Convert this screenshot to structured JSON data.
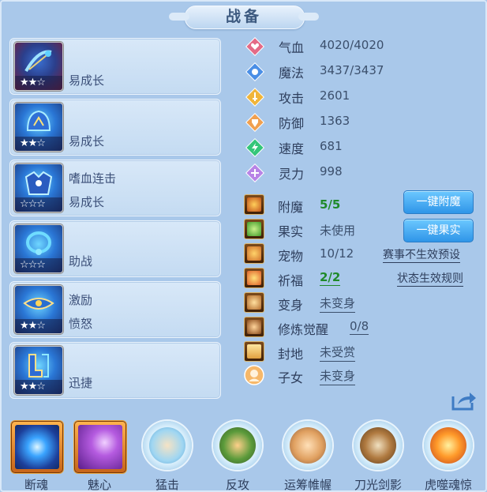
{
  "title": "战备",
  "equipment": [
    {
      "line1": "",
      "line2": "易成长",
      "stars": "★★☆"
    },
    {
      "line1": "",
      "line2": "易成长",
      "stars": "★★☆"
    },
    {
      "line1": "嗜血连击",
      "line2": "易成长",
      "stars": "☆☆☆"
    },
    {
      "line1": "",
      "line2": "助战",
      "stars": "☆☆☆"
    },
    {
      "line1": "激励",
      "line2": "愤怒",
      "stars": "★★☆"
    },
    {
      "line1": "",
      "line2": "迅捷",
      "stars": "★★☆"
    }
  ],
  "stats": [
    {
      "label": "气血",
      "value": "4020/4020",
      "color": "#e46a86",
      "icon": "heart-icon"
    },
    {
      "label": "魔法",
      "value": "3437/3437",
      "color": "#4b8fe6",
      "icon": "mana-icon"
    },
    {
      "label": "攻击",
      "value": "2601",
      "color": "#f0b53a",
      "icon": "sword-icon"
    },
    {
      "label": "防御",
      "value": "1363",
      "color": "#f0a050",
      "icon": "shield-icon"
    },
    {
      "label": "速度",
      "value": "681",
      "color": "#34c67a",
      "icon": "lightning-icon"
    },
    {
      "label": "灵力",
      "value": "998",
      "color": "#b884e6",
      "icon": "spirit-icon"
    }
  ],
  "details": {
    "enchant": {
      "label": "附魔",
      "value": "5/5"
    },
    "fruit": {
      "label": "果实",
      "value": "未使用"
    },
    "pet": {
      "label": "宠物",
      "value": "10/12"
    },
    "blessing": {
      "label": "祈福",
      "value": "2/2"
    },
    "transform": {
      "label": "变身",
      "value": "未变身"
    },
    "cultivation": {
      "label": "修炼觉醒",
      "value": "0/8"
    },
    "fief": {
      "label": "封地",
      "value": "未受赏"
    },
    "children": {
      "label": "子女",
      "value": "未变身"
    }
  },
  "buttons": {
    "one_click_enchant": "一键附魔",
    "one_click_fruit": "一键果实"
  },
  "links": {
    "event_preset": "赛事不生效预设",
    "status_rules": "状态生效规则"
  },
  "skills": [
    {
      "name": "断魂",
      "style": "square",
      "icon": "soul-orb-icon"
    },
    {
      "name": "魅心",
      "style": "square",
      "icon": "charm-hand-icon"
    },
    {
      "name": "猛击",
      "style": "round",
      "icon": "fist-icon"
    },
    {
      "name": "反攻",
      "style": "round",
      "icon": "counter-blade-icon"
    },
    {
      "name": "运筹帷幄",
      "style": "round",
      "icon": "raised-fist-icon"
    },
    {
      "name": "刀光剑影",
      "style": "round",
      "icon": "blade-icon"
    },
    {
      "name": "虎噬魂惊",
      "style": "round",
      "icon": "fire-tiger-icon"
    }
  ]
}
